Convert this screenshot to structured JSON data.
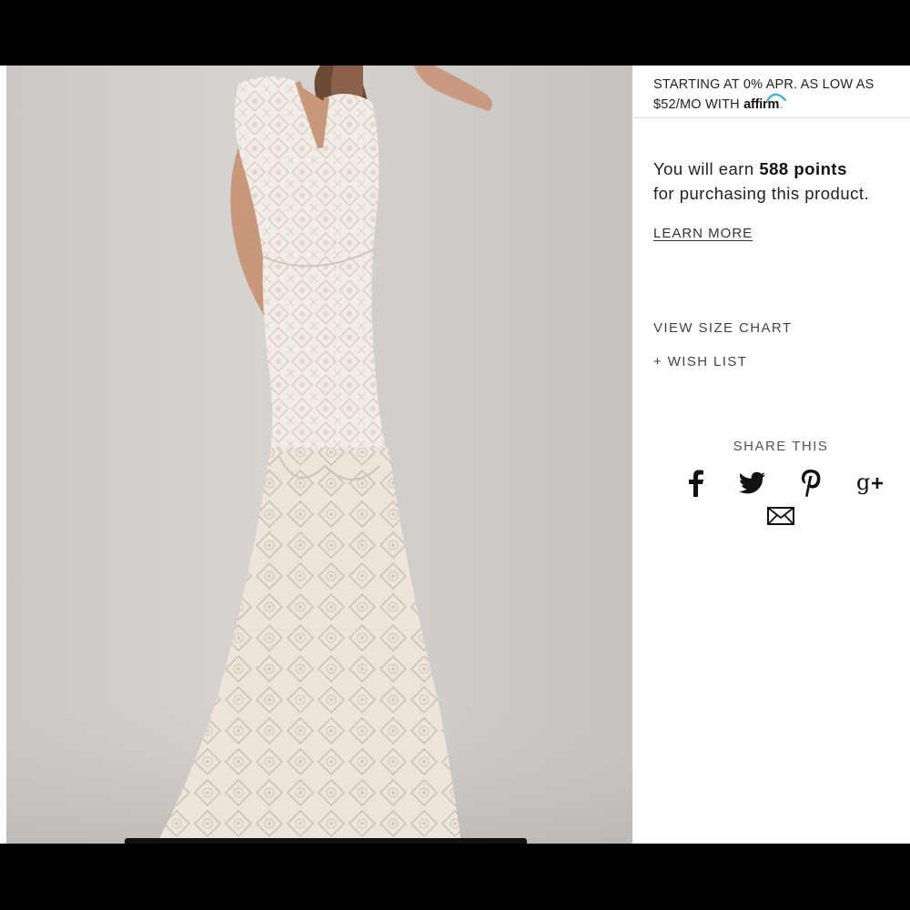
{
  "financing": {
    "line1": "STARTING AT 0% APR. AS LOW AS",
    "line2_prefix": "$52/MO WITH",
    "affirm_brand": "affirm",
    "line2_suffix": "."
  },
  "rewards": {
    "prefix": "You will earn",
    "points": "588 points",
    "suffix": "for purchasing this product."
  },
  "learn_more": "LEARN MORE",
  "size_chart": "VIEW SIZE CHART",
  "wish_list": "+ WISH LIST",
  "share": {
    "title": "SHARE THIS",
    "icons": [
      "facebook-icon",
      "twitter-icon",
      "pinterest-icon",
      "google-plus-icon",
      "email-icon"
    ]
  },
  "colors": {
    "affirm_arc": "#4aa7d8",
    "text": "#222222"
  }
}
